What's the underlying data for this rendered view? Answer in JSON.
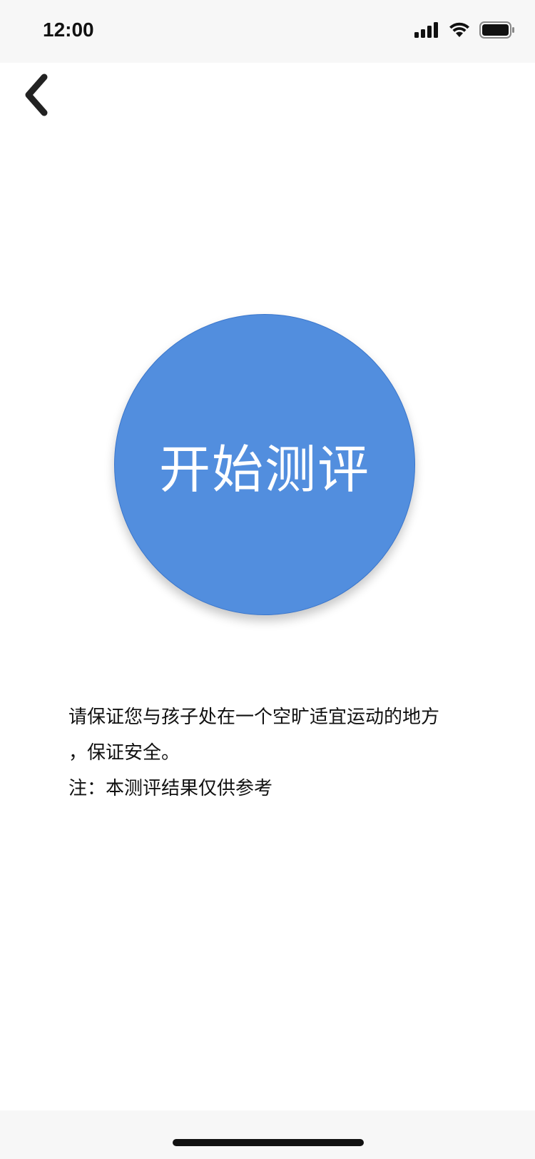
{
  "status_bar": {
    "time": "12:00",
    "icons": [
      "signal-icon",
      "wifi-icon",
      "battery-icon"
    ]
  },
  "nav": {
    "back_icon": "chevron-left-icon"
  },
  "main": {
    "start_button_label": "开始测评",
    "button_color": "#528ede",
    "notice_lines": [
      "请保证您与孩子处在一个空旷适宜运动的地方",
      "，保证安全。",
      "注：本测评结果仅供参考"
    ]
  }
}
